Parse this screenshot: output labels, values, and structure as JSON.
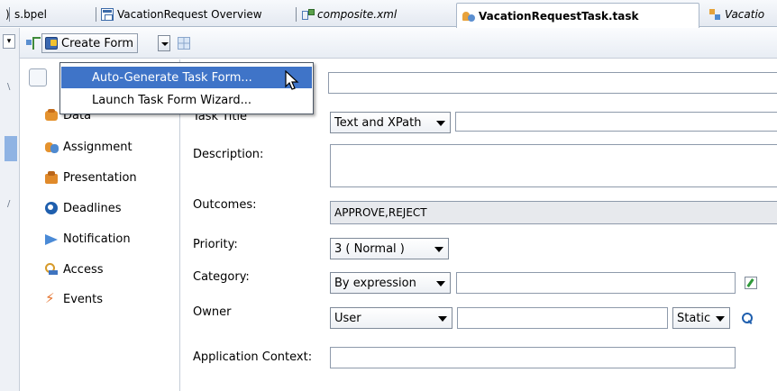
{
  "tabs": [
    {
      "label": "s.bpel",
      "icon": "none"
    },
    {
      "label": "VacationRequest Overview",
      "icon": "overview-icon"
    },
    {
      "label": "composite.xml",
      "icon": "composite-icon"
    },
    {
      "label": "VacationRequestTask.task",
      "icon": "task-icon",
      "active": true
    },
    {
      "label": "Vacatio",
      "icon": "bpel-icon"
    }
  ],
  "toolbar": {
    "create_form_label": "Create Form"
  },
  "menu": {
    "items": [
      {
        "label": "Auto-Generate Task Form...",
        "highlighted": true
      },
      {
        "label": "Launch Task Form Wizard..."
      }
    ]
  },
  "sidebar": {
    "items": [
      {
        "label": "Data",
        "icon": "data-icon"
      },
      {
        "label": "Assignment",
        "icon": "assignment-icon"
      },
      {
        "label": "Presentation",
        "icon": "presentation-icon"
      },
      {
        "label": "Deadlines",
        "icon": "deadlines-icon"
      },
      {
        "label": "Notification",
        "icon": "notification-icon"
      },
      {
        "label": "Access",
        "icon": "access-icon"
      },
      {
        "label": "Events",
        "icon": "events-icon"
      }
    ]
  },
  "form": {
    "task_title_label": "Task Title",
    "task_title_mode": "Text and XPath",
    "task_title_value": "",
    "description_label": "Description:",
    "description_value": "",
    "outcomes_label": "Outcomes:",
    "outcomes_value": "APPROVE,REJECT",
    "priority_label": "Priority:",
    "priority_value": "3 ( Normal )",
    "category_label": "Category:",
    "category_mode": "By expression",
    "category_value": "",
    "owner_label": "Owner",
    "owner_type": "User",
    "owner_value": "",
    "owner_binding": "Static",
    "app_context_label": "Application Context:",
    "app_context_value": ""
  },
  "colors": {
    "menu_highlight": "#3f74c8",
    "readonly_bg": "#e7e9ed"
  }
}
